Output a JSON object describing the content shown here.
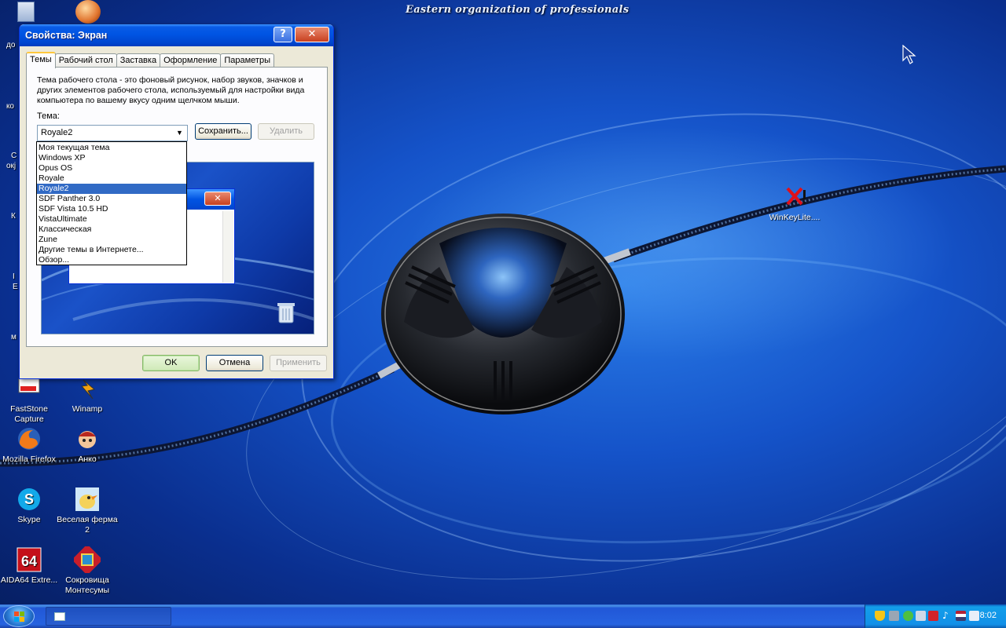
{
  "desktop": {
    "banner": "Eastern organization of professionals",
    "partial_labels": [
      "до",
      "кo",
      "С",
      "окј",
      "К",
      "I",
      "Е",
      "м"
    ],
    "icons": [
      {
        "label": "FastStone\nCapture",
        "icon": "faststone-icon"
      },
      {
        "label": "Winamp",
        "icon": "winamp-icon"
      },
      {
        "label": "Mozilla Firefox",
        "icon": "firefox-icon"
      },
      {
        "label": "Анко",
        "icon": "anko-icon"
      },
      {
        "label": "Skype",
        "icon": "skype-icon"
      },
      {
        "label": "Веселая ферма 2",
        "icon": "farm-icon"
      },
      {
        "label": "AIDA64 Extre...",
        "icon": "aida64-icon"
      },
      {
        "label": "Сокровища Монтесумы",
        "icon": "montezuma-icon"
      },
      {
        "label": "WinKeyLite....",
        "icon": "winkey-icon"
      }
    ],
    "aida_badge": "64"
  },
  "dialog": {
    "title": "Свойства: Экран",
    "help_label": "?",
    "close_label": "✕",
    "tabs": [
      "Темы",
      "Рабочий стол",
      "Заставка",
      "Оформление",
      "Параметры"
    ],
    "active_tab": "Темы",
    "description": "Тема рабочего стола - это фоновый рисунок, набор звуков, значков и других элементов рабочего стола, используемый для настройки вида компьютера по вашему вкусу одним щелчком мыши.",
    "theme_label": "Тема:",
    "theme_value": "Royale2",
    "save_label": "Сохранить...",
    "delete_label": "Удалить",
    "ok_label": "OK",
    "cancel_label": "Отмена",
    "apply_label": "Применить",
    "dropdown_items": [
      "Моя текущая тема",
      "Windows XP",
      "Opus OS",
      "Royale",
      "Royale2",
      "SDF Panther 3.0",
      "SDF Vista 10.5 HD",
      "VistaUltimate",
      "Классическая",
      "Zune",
      "Другие темы в Интернете...",
      "Обзор..."
    ],
    "selected_item": "Royale2",
    "preview_close": "✕"
  },
  "taskbar": {
    "clock": "8:02"
  },
  "colors": {
    "title_blue": "#0054e3",
    "selection": "#316ac5",
    "desktop": "#1553c9"
  }
}
